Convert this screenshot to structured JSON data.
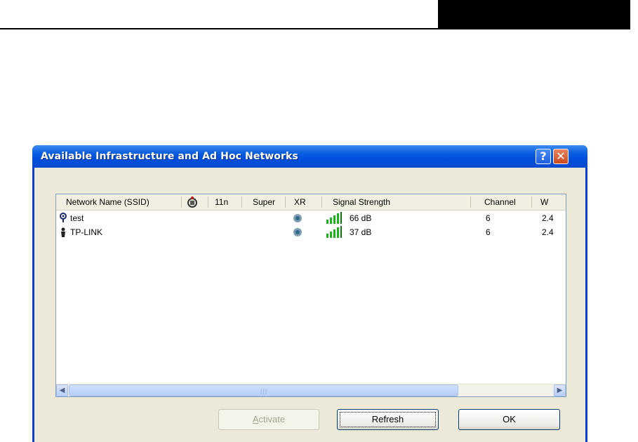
{
  "dialog": {
    "title": "Available Infrastructure and Ad Hoc Networks",
    "help_label": "?",
    "close_label": "✕"
  },
  "list": {
    "columns": [
      {
        "label": "Network Name (SSID)"
      },
      {
        "label": ""
      },
      {
        "label": "11n"
      },
      {
        "label": "Super"
      },
      {
        "label": "XR"
      },
      {
        "label": "Signal Strength"
      },
      {
        "label": "Channel"
      },
      {
        "label": "W"
      }
    ],
    "rows": [
      {
        "ssid": "test",
        "mode_icon": "access-point-icon",
        "xr_icon": "xr-icon",
        "signal": "66 dB",
        "channel": "6",
        "w": "2.4"
      },
      {
        "ssid": "TP-LINK",
        "mode_icon": "ad-hoc-icon",
        "xr_icon": "xr-icon",
        "signal": "37 dB",
        "channel": "6",
        "w": "2.4"
      }
    ]
  },
  "buttons": {
    "activate_first": "A",
    "activate_rest": "ctivate",
    "refresh": "Refresh",
    "ok": "OK"
  },
  "colors": {
    "titlebar": "#0a5fe0",
    "signal_green": "#18b418"
  }
}
